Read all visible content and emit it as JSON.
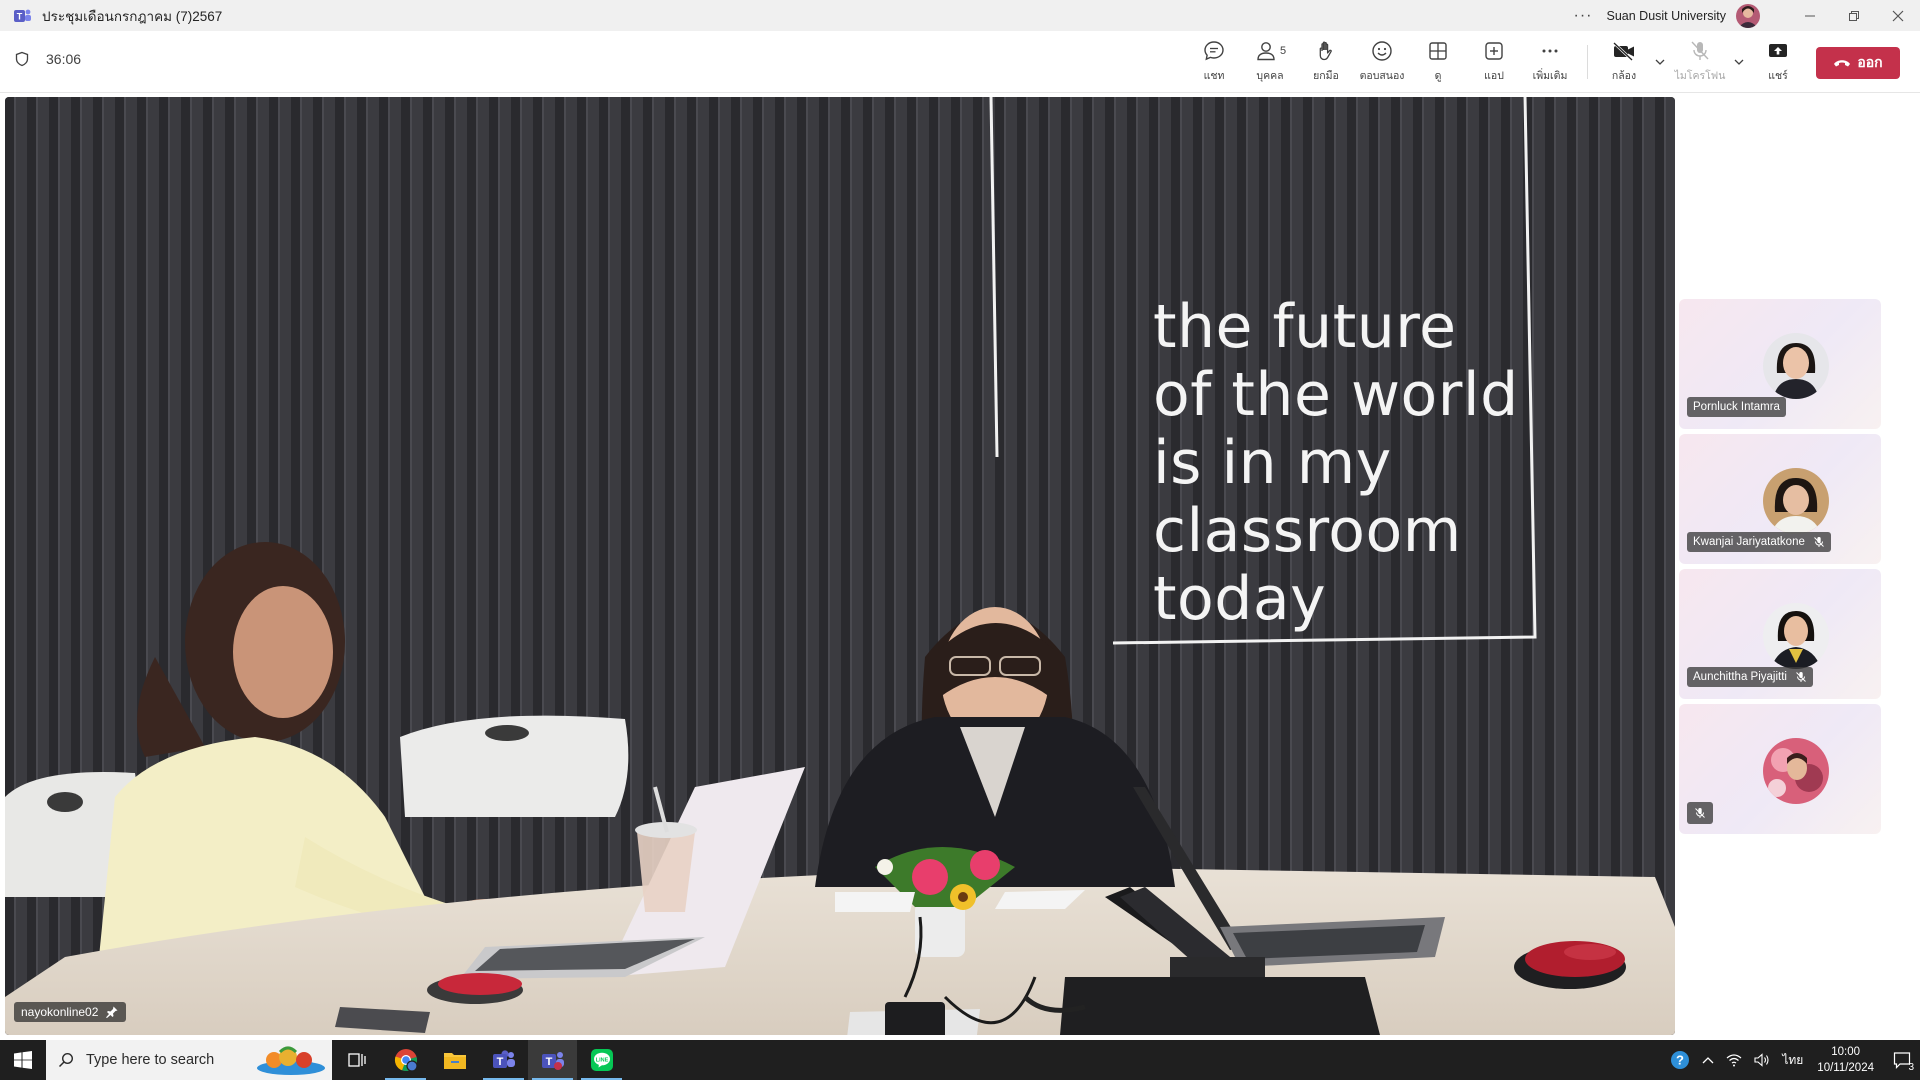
{
  "window": {
    "title": "ประชุมเดือนกรกฎาคม (7)2567",
    "more": "···",
    "organization": "Suan Dusit University"
  },
  "toolbar": {
    "timer": "36:06",
    "chat": "แชท",
    "people": "บุคคล",
    "people_count": "5",
    "raise_hand": "ยกมือ",
    "react": "ตอบสนอง",
    "view": "ดู",
    "apps": "แอป",
    "more": "เพิ่มเติม",
    "camera": "กล้อง",
    "mic": "ไมโครโฟน",
    "share": "แชร์",
    "leave": "ออก"
  },
  "main_video": {
    "participant": "nayokonline02",
    "wall_text": [
      "the future",
      "of the world",
      "is in my",
      "classroom",
      "today"
    ]
  },
  "participants": [
    {
      "name": "Pornluck Intamra",
      "muted": false
    },
    {
      "name": "Kwanjai Jariyatatkone",
      "muted": true
    },
    {
      "name": "Aunchittha Piyajitti",
      "muted": true
    },
    {
      "name": "",
      "muted": true
    }
  ],
  "taskbar": {
    "search_placeholder": "Type here to search",
    "language": "ไทย",
    "time": "10:00",
    "date": "10/11/2024",
    "notification_count": "3"
  },
  "colors": {
    "leave": "#c4314b",
    "teams_purple": "#5b5fc7",
    "taskbar": "#1f1f1f",
    "toolbar": "#ffffff"
  }
}
